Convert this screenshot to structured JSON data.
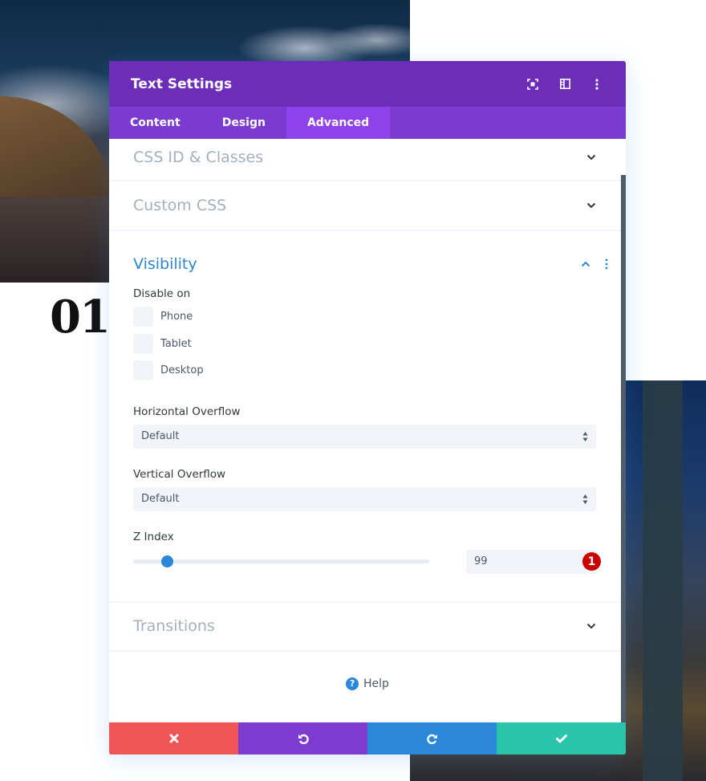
{
  "background": {
    "number_label": "01"
  },
  "modal": {
    "title": "Text Settings",
    "header_icons": [
      "fullscreen-icon",
      "split-view-icon",
      "more-options-icon"
    ],
    "tabs": [
      {
        "label": "Content",
        "active": false
      },
      {
        "label": "Design",
        "active": false
      },
      {
        "label": "Advanced",
        "active": true
      }
    ],
    "sections": {
      "css_id": {
        "title": "CSS ID & Classes",
        "expanded": false
      },
      "custom_css": {
        "title": "Custom CSS",
        "expanded": false
      },
      "visibility": {
        "title": "Visibility",
        "expanded": true,
        "disable_on_label": "Disable on",
        "checkboxes": [
          {
            "label": "Phone",
            "checked": false
          },
          {
            "label": "Tablet",
            "checked": false
          },
          {
            "label": "Desktop",
            "checked": false
          }
        ],
        "horizontal_overflow": {
          "label": "Horizontal Overflow",
          "value": "Default"
        },
        "vertical_overflow": {
          "label": "Vertical Overflow",
          "value": "Default"
        },
        "z_index": {
          "label": "Z Index",
          "value": "99",
          "slider_fraction": 0.115,
          "badge": "1"
        }
      },
      "transitions": {
        "title": "Transitions",
        "expanded": false
      }
    },
    "help_label": "Help",
    "footer": {
      "buttons": [
        {
          "name": "cancel",
          "icon": "close-icon",
          "color": "#ef5555"
        },
        {
          "name": "undo",
          "icon": "undo-icon",
          "color": "#7e3bd0"
        },
        {
          "name": "redo",
          "icon": "redo-icon",
          "color": "#2b87da"
        },
        {
          "name": "save",
          "icon": "check-icon",
          "color": "#29c4a9"
        }
      ]
    },
    "colors": {
      "header": "#6c2eb9",
      "tabs": "#7b3bd0",
      "active_tab": "#8f42ec",
      "accent": "#2b87da",
      "badge": "#cc0000"
    }
  }
}
